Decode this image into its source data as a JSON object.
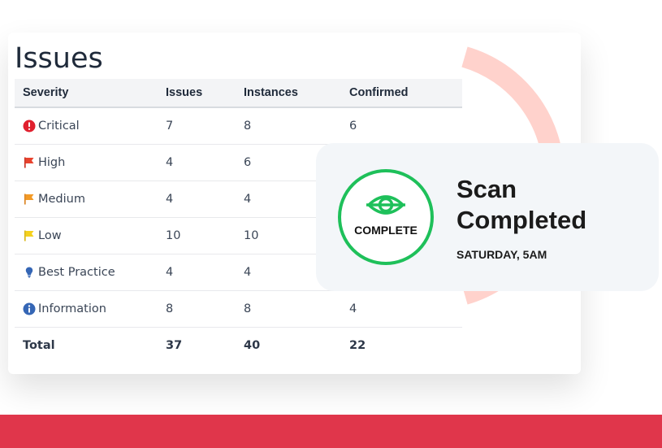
{
  "title": "Issues",
  "table": {
    "headers": [
      "Severity",
      "Issues",
      "Instances",
      "Confirmed"
    ],
    "rows": [
      {
        "severity": "Critical",
        "icon": "exclamation-circle-icon",
        "issues": "7",
        "instances": "8",
        "confirmed": "6"
      },
      {
        "severity": "High",
        "icon": "red-flag-icon",
        "issues": "4",
        "instances": "6",
        "confirmed": ""
      },
      {
        "severity": "Medium",
        "icon": "orange-flag-icon",
        "issues": "4",
        "instances": "4",
        "confirmed": ""
      },
      {
        "severity": "Low",
        "icon": "yellow-flag-icon",
        "issues": "10",
        "instances": "10",
        "confirmed": ""
      },
      {
        "severity": "Best Practice",
        "icon": "lightbulb-icon",
        "issues": "4",
        "instances": "4",
        "confirmed": ""
      },
      {
        "severity": "Information",
        "icon": "info-circle-icon",
        "issues": "8",
        "instances": "8",
        "confirmed": "4"
      }
    ],
    "total": {
      "label": "Total",
      "issues": "37",
      "instances": "40",
      "confirmed": "22"
    }
  },
  "scan": {
    "badge_label": "COMPLETE",
    "title_line1": "Scan",
    "title_line2": "Completed",
    "date": "SATURDAY, 5AM",
    "icon": "eye-icon"
  },
  "colors": {
    "accent_red": "#e0364b",
    "arc": "#ffd2cc",
    "badge_green": "#1ec05a",
    "critical": "#e0202e",
    "high": "#e8432e",
    "medium": "#f39a26",
    "low": "#f5d11c",
    "info": "#3566b5"
  }
}
